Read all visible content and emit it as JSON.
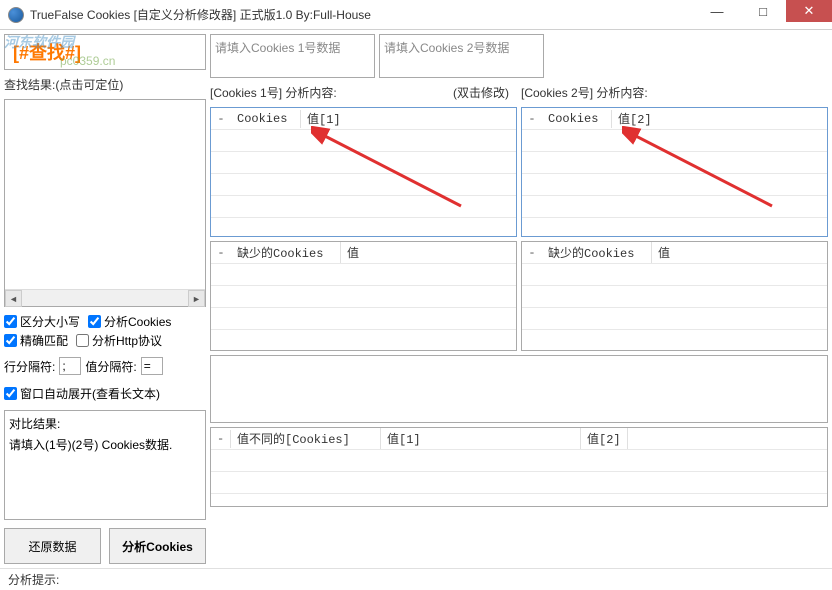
{
  "window": {
    "title": "TrueFalse Cookies [自定义分析修改器] 正式版1.0            By:Full-House",
    "min": "—",
    "max": "□",
    "close": "✕"
  },
  "watermark": {
    "line1": "河东软件园",
    "line2": "pc0359.cn"
  },
  "left": {
    "search_placeholder": "[#查找#]",
    "results_label": "查找结果:(点击可定位)",
    "opt_case": "区分大小写",
    "opt_cookies": "分析Cookies",
    "opt_exact": "精确匹配",
    "opt_http": "分析Http协议",
    "rowsep_label": "行分隔符:",
    "rowsep_val": ";",
    "valsep_label": "值分隔符:",
    "valsep_val": "=",
    "autoexpand": "窗口自动展开(查看长文本)",
    "compare_label": "对比结果:",
    "compare_msg": "请填入(1号)(2号) Cookies数据.",
    "btn_restore": "还原数据",
    "btn_analyze": "分析Cookies"
  },
  "right": {
    "input1_placeholder": "请填入Cookies 1号数据",
    "input2_placeholder": "请填入Cookies 2号数据",
    "label1": "[Cookies 1号] 分析内容:",
    "label1_hint": "(双击修改)",
    "label2": "[Cookies 2号] 分析内容:",
    "grid1": {
      "col1": "Cookies",
      "col2": "值[1]"
    },
    "grid2": {
      "col1": "Cookies",
      "col2": "值[2]"
    },
    "missing1": {
      "col1": "缺少的Cookies",
      "col2": "值"
    },
    "missing2": {
      "col1": "缺少的Cookies",
      "col2": "值"
    },
    "diff": {
      "col1": "值不同的[Cookies]",
      "col2": "值[1]",
      "col3": "值[2]"
    }
  },
  "status": "分析提示:"
}
